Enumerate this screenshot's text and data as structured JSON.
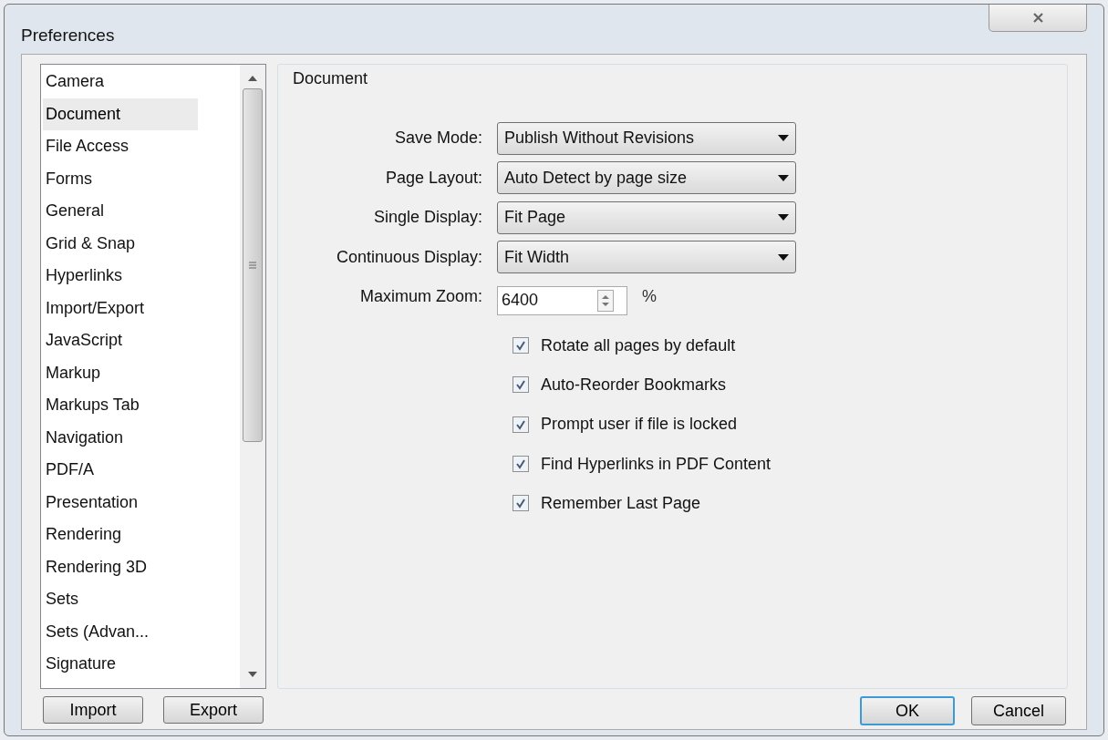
{
  "window": {
    "title": "Preferences"
  },
  "sidebar": {
    "items": [
      {
        "label": "Camera",
        "selected": false
      },
      {
        "label": "Document",
        "selected": true
      },
      {
        "label": "File Access",
        "selected": false
      },
      {
        "label": "Forms",
        "selected": false
      },
      {
        "label": "General",
        "selected": false
      },
      {
        "label": "Grid & Snap",
        "selected": false
      },
      {
        "label": "Hyperlinks",
        "selected": false
      },
      {
        "label": "Import/Export",
        "selected": false
      },
      {
        "label": "JavaScript",
        "selected": false
      },
      {
        "label": "Markup",
        "selected": false
      },
      {
        "label": "Markups Tab",
        "selected": false
      },
      {
        "label": "Navigation",
        "selected": false
      },
      {
        "label": "PDF/A",
        "selected": false
      },
      {
        "label": "Presentation",
        "selected": false
      },
      {
        "label": "Rendering",
        "selected": false
      },
      {
        "label": "Rendering 3D",
        "selected": false
      },
      {
        "label": "Sets",
        "selected": false
      },
      {
        "label": "Sets (Advan...",
        "selected": false
      },
      {
        "label": "Signature",
        "selected": false
      }
    ],
    "buttons": [
      "Import",
      "Export"
    ]
  },
  "group": {
    "title": "Document",
    "fields": [
      {
        "kind": "dropdown",
        "label": "Save Mode:",
        "value": "Publish Without Revisions"
      },
      {
        "kind": "dropdown",
        "label": "Page Layout:",
        "value": "Auto Detect by page size"
      },
      {
        "kind": "dropdown",
        "label": "Single Display:",
        "value": "Fit Page"
      },
      {
        "kind": "dropdown",
        "label": "Continuous Display:",
        "value": "Fit Width"
      },
      {
        "kind": "spin",
        "label": "Maximum Zoom:",
        "value": "6400",
        "unit": "%"
      }
    ],
    "checkboxes": [
      {
        "label": "Rotate all pages by default",
        "checked": true
      },
      {
        "label": "Auto-Reorder Bookmarks",
        "checked": true
      },
      {
        "label": "Prompt user if file is locked",
        "checked": true
      },
      {
        "label": "Find Hyperlinks in PDF Content",
        "checked": true
      },
      {
        "label": "Remember Last Page",
        "checked": true
      }
    ]
  },
  "footer": {
    "buttons": [
      {
        "label": "OK",
        "default": true
      },
      {
        "label": "Cancel",
        "default": false
      }
    ]
  }
}
